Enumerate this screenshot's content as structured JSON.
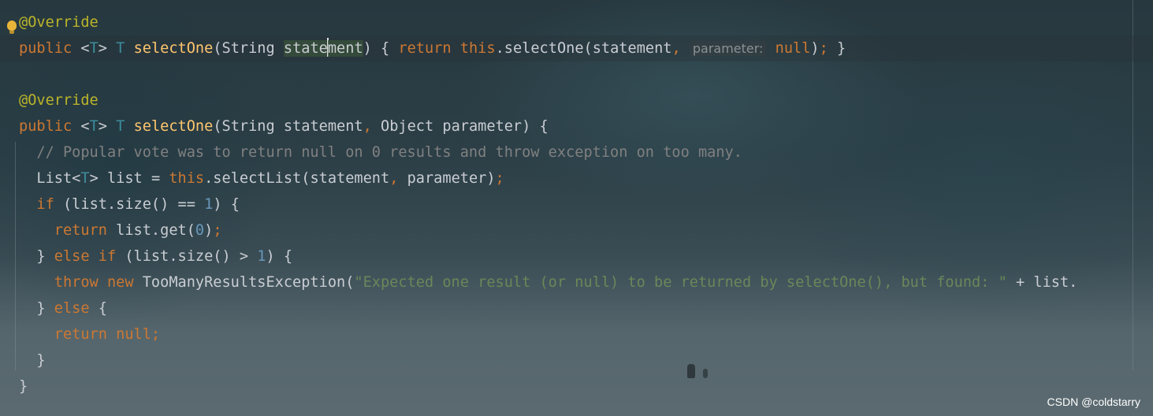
{
  "watermark": "CSDN @coldstarry",
  "code_lines": [
    {
      "name": "line-1",
      "tokens": [
        {
          "t": "@Override",
          "c": "ann"
        }
      ]
    },
    {
      "name": "line-2",
      "current": true,
      "tokens": [
        {
          "t": "public ",
          "c": "kw"
        },
        {
          "t": "<",
          "c": "plain"
        },
        {
          "t": "T",
          "c": "gen"
        },
        {
          "t": "> ",
          "c": "plain"
        },
        {
          "t": "T ",
          "c": "gen"
        },
        {
          "t": "selectOne",
          "c": "meth"
        },
        {
          "t": "(String ",
          "c": "plain"
        },
        {
          "t": "state",
          "c": "hl"
        },
        {
          "t": "",
          "c": "caret"
        },
        {
          "t": "ment",
          "c": "hl"
        },
        {
          "t": ") { ",
          "c": "plain"
        },
        {
          "t": "return ",
          "c": "kw"
        },
        {
          "t": "this",
          "c": "kw"
        },
        {
          "t": ".selectOne(statement",
          "c": "plain"
        },
        {
          "t": ", ",
          "c": "kw"
        },
        {
          "t": "parameter:",
          "c": "hint"
        },
        {
          "t": " ",
          "c": "plain"
        },
        {
          "t": "null",
          "c": "kw"
        },
        {
          "t": ")",
          "c": "plain"
        },
        {
          "t": ";",
          "c": "kw"
        },
        {
          "t": " }",
          "c": "plain"
        }
      ]
    },
    {
      "name": "line-3",
      "tokens": []
    },
    {
      "name": "line-4",
      "tokens": [
        {
          "t": "@Override",
          "c": "ann"
        }
      ]
    },
    {
      "name": "line-5",
      "tokens": [
        {
          "t": "public ",
          "c": "kw"
        },
        {
          "t": "<",
          "c": "plain"
        },
        {
          "t": "T",
          "c": "gen"
        },
        {
          "t": "> ",
          "c": "plain"
        },
        {
          "t": "T ",
          "c": "gen"
        },
        {
          "t": "selectOne",
          "c": "meth"
        },
        {
          "t": "(String statement",
          "c": "plain"
        },
        {
          "t": ", ",
          "c": "kw"
        },
        {
          "t": "Object parameter) {",
          "c": "plain"
        }
      ]
    },
    {
      "name": "line-6",
      "tokens": [
        {
          "t": "  // Popular vote was to return null on 0 results and throw exception on too many.",
          "c": "cmt"
        }
      ]
    },
    {
      "name": "line-7",
      "tokens": [
        {
          "t": "  List<",
          "c": "plain"
        },
        {
          "t": "T",
          "c": "gen"
        },
        {
          "t": "> list = ",
          "c": "plain"
        },
        {
          "t": "this",
          "c": "kw"
        },
        {
          "t": ".selectList(statement",
          "c": "plain"
        },
        {
          "t": ", ",
          "c": "kw"
        },
        {
          "t": "parameter)",
          "c": "plain"
        },
        {
          "t": ";",
          "c": "kw"
        }
      ]
    },
    {
      "name": "line-8",
      "tokens": [
        {
          "t": "  ",
          "c": "plain"
        },
        {
          "t": "if ",
          "c": "kw"
        },
        {
          "t": "(list.size() == ",
          "c": "plain"
        },
        {
          "t": "1",
          "c": "num"
        },
        {
          "t": ") {",
          "c": "plain"
        }
      ]
    },
    {
      "name": "line-9",
      "tokens": [
        {
          "t": "    ",
          "c": "plain"
        },
        {
          "t": "return ",
          "c": "kw"
        },
        {
          "t": "list.get(",
          "c": "plain"
        },
        {
          "t": "0",
          "c": "num"
        },
        {
          "t": ")",
          "c": "plain"
        },
        {
          "t": ";",
          "c": "kw"
        }
      ]
    },
    {
      "name": "line-10",
      "tokens": [
        {
          "t": "  } ",
          "c": "plain"
        },
        {
          "t": "else if ",
          "c": "kw"
        },
        {
          "t": "(list.size() > ",
          "c": "plain"
        },
        {
          "t": "1",
          "c": "num"
        },
        {
          "t": ") {",
          "c": "plain"
        }
      ]
    },
    {
      "name": "line-11",
      "tokens": [
        {
          "t": "    ",
          "c": "plain"
        },
        {
          "t": "throw new ",
          "c": "kw"
        },
        {
          "t": "TooManyResultsException(",
          "c": "plain"
        },
        {
          "t": "\"Expected one result (or null) to be returned by selectOne(), but found: \"",
          "c": "str"
        },
        {
          "t": " + list.",
          "c": "plain"
        }
      ]
    },
    {
      "name": "line-12",
      "tokens": [
        {
          "t": "  } ",
          "c": "plain"
        },
        {
          "t": "else ",
          "c": "kw"
        },
        {
          "t": "{",
          "c": "plain"
        }
      ]
    },
    {
      "name": "line-13",
      "tokens": [
        {
          "t": "    ",
          "c": "plain"
        },
        {
          "t": "return null;",
          "c": "kw"
        }
      ]
    },
    {
      "name": "line-14",
      "tokens": [
        {
          "t": "  }",
          "c": "plain"
        }
      ]
    },
    {
      "name": "line-15",
      "tokens": [
        {
          "t": "}",
          "c": "plain"
        }
      ]
    }
  ]
}
